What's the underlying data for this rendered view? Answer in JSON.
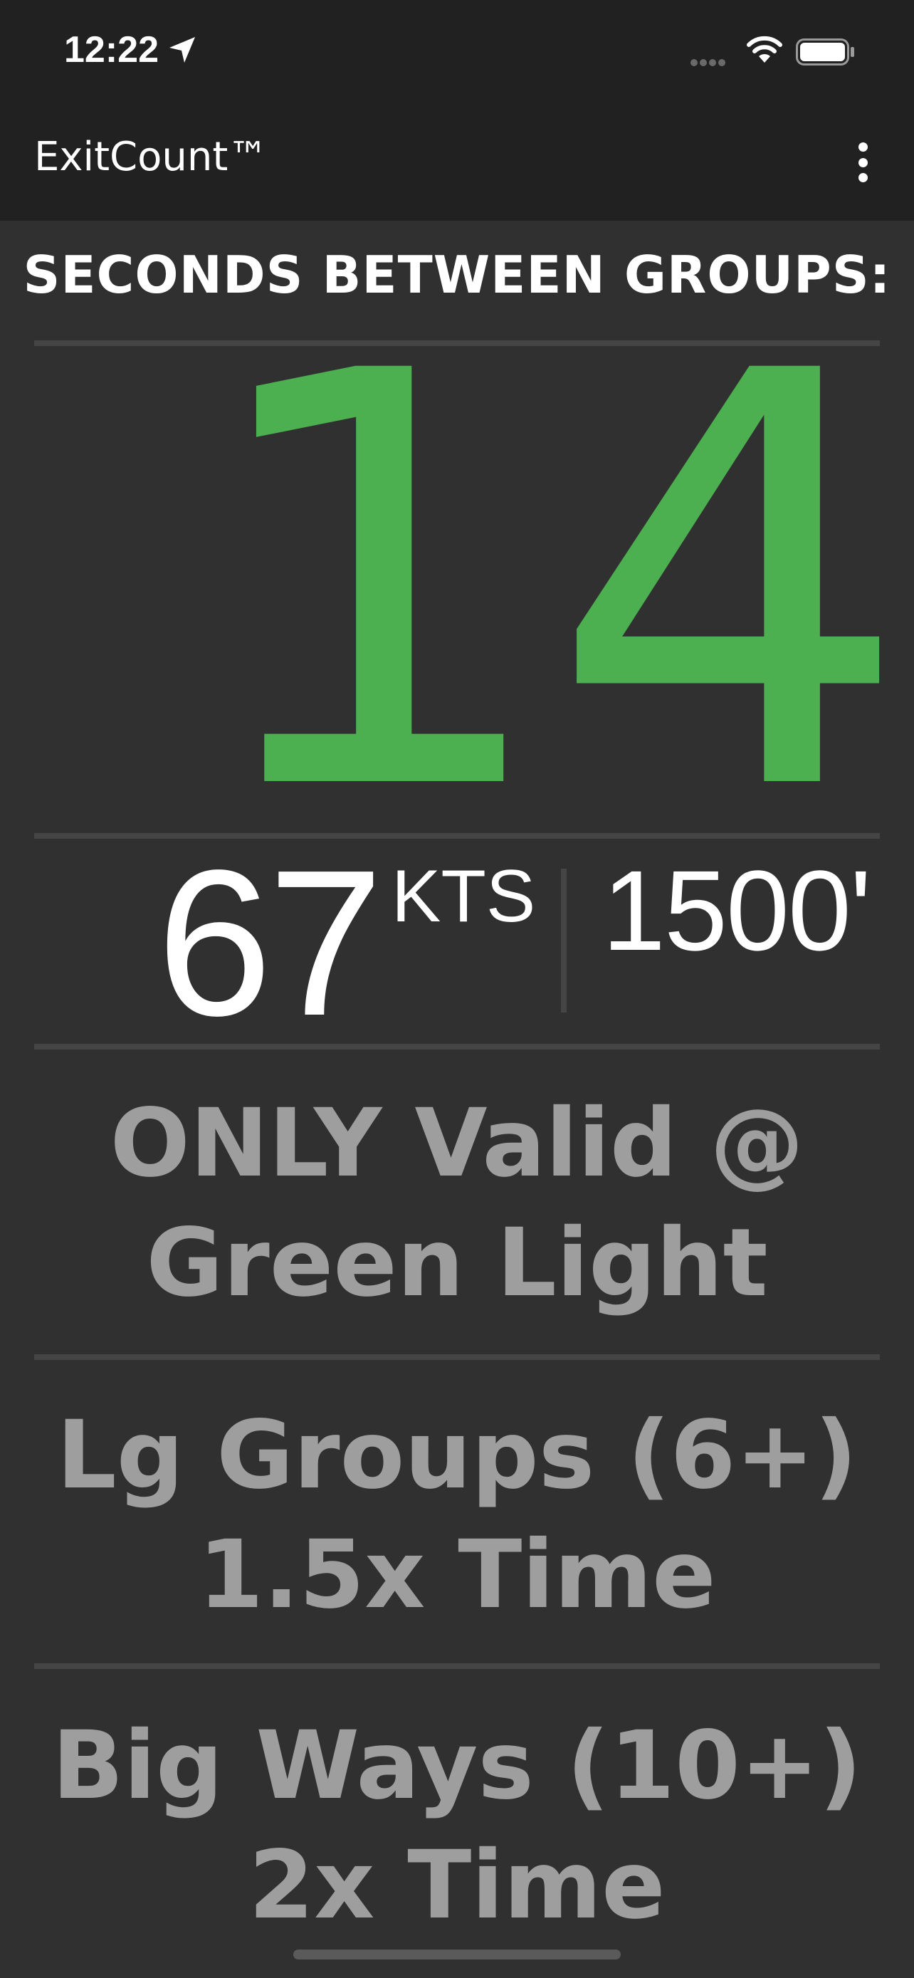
{
  "status_bar": {
    "time": "12:22"
  },
  "app_bar": {
    "title": "ExitCount™"
  },
  "main": {
    "heading": "SECONDS BETWEEN GROUPS:",
    "seconds": "14",
    "speed": "67",
    "speed_unit": "KTS",
    "altitude": "1500'",
    "notes": [
      {
        "line1": "ONLY Valid @",
        "line2": "Green Light"
      },
      {
        "line1": "Lg Groups (6+)",
        "line2": "1.5x Time"
      },
      {
        "line1": "Big Ways (10+)",
        "line2": "2x Time"
      }
    ]
  },
  "colors": {
    "accent": "#4caf50",
    "background": "#303030",
    "bar_background": "#212121",
    "note_text": "#9e9e9e",
    "divider": "#454545"
  },
  "icons": [
    "location-arrow-icon",
    "cellular-signal-icon",
    "wifi-icon",
    "battery-icon",
    "more-vert-icon"
  ]
}
